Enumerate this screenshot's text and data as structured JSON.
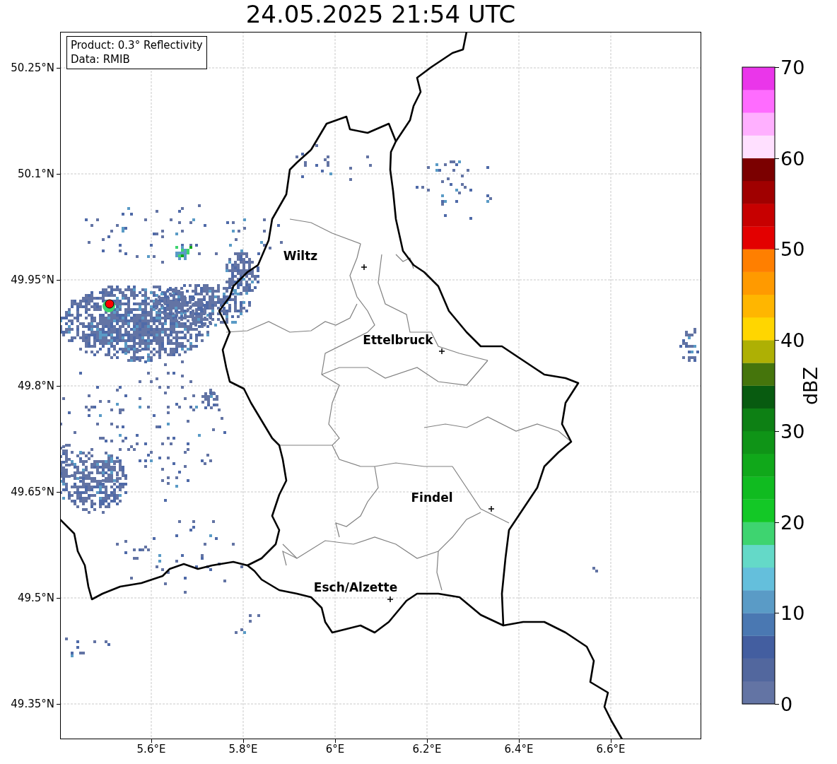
{
  "title": "24.05.2025 21:54 UTC",
  "info_box": [
    "Product: 0.3° Reflectivity",
    "Data: RMIB"
  ],
  "y_ticks": [
    "50.25°N",
    "50.1°N",
    "49.95°N",
    "49.8°N",
    "49.65°N",
    "49.5°N",
    "49.35°N"
  ],
  "x_ticks": [
    "5.6°E",
    "5.8°E",
    "6°E",
    "6.2°E",
    "6.4°E",
    "6.6°E"
  ],
  "cities": [
    {
      "name": "Wiltz"
    },
    {
      "name": "Ettelbruck"
    },
    {
      "name": "Findel"
    },
    {
      "name": "Esch/Alzette"
    }
  ],
  "colorbar": {
    "label": "dBZ",
    "ticks": [
      "70",
      "60",
      "50",
      "40",
      "30",
      "20",
      "10",
      "0"
    ],
    "bins": [
      {
        "color": "#6374a4"
      },
      {
        "color": "#52679e"
      },
      {
        "color": "#435ea0"
      },
      {
        "color": "#4a78b2"
      },
      {
        "color": "#5a9bc6"
      },
      {
        "color": "#64bfdc"
      },
      {
        "color": "#64d9c8"
      },
      {
        "color": "#3ed470"
      },
      {
        "color": "#13c826"
      },
      {
        "color": "#10bb20"
      },
      {
        "color": "#10a81a"
      },
      {
        "color": "#0f9417"
      },
      {
        "color": "#0d8014"
      },
      {
        "color": "#085b10"
      },
      {
        "color": "#45750c"
      },
      {
        "color": "#aeb004"
      },
      {
        "color": "#ffd600"
      },
      {
        "color": "#ffb600"
      },
      {
        "color": "#ff9a00"
      },
      {
        "color": "#ff7f00"
      },
      {
        "color": "#e30000"
      },
      {
        "color": "#c70000"
      },
      {
        "color": "#a00000"
      },
      {
        "color": "#7b0000"
      },
      {
        "color": "#ffe0ff"
      },
      {
        "color": "#ffb0ff"
      },
      {
        "color": "#ff6cff"
      },
      {
        "color": "#ea36ea"
      }
    ]
  }
}
